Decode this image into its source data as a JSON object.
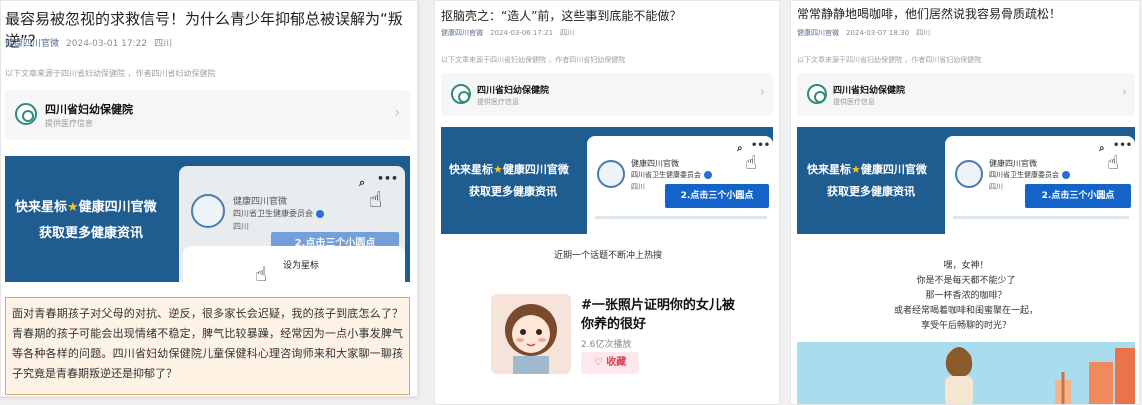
{
  "panels": [
    {
      "title": "最容易被忽视的求救信号！为什么青少年抑郁总被误解为“叛逆”？",
      "author": "健康四川官微",
      "datetime": "2024-03-01 17:22",
      "location": "四川",
      "source": "以下文章来源于四川省妇幼保健院 ，作者四川省妇幼保健院",
      "card": {
        "name": "四川省妇幼保健院",
        "desc": "提供医疗信息"
      },
      "banner": {
        "line1_a": "快来星标",
        "line1_b": "健康四川官微",
        "line2": "获取更多健康资讯",
        "account_name": "健康四川官微",
        "account_dept": "四川省卫生健康委员会",
        "account_loc": "四川",
        "button": "2.点击三个小圆点",
        "popup": "设为星标"
      },
      "intro": "面对青春期孩子对父母的对抗、逆反，很多家长会迟疑，我的孩子到底怎么了？青春期的孩子可能会出现情绪不稳定，脾气比较暴躁，经常因为一点小事发脾气等各种各样的问题。四川省妇幼保健院儿童保健科心理咨询师来和大家聊一聊孩子究竟是青春期叛逆还是抑郁了？"
    },
    {
      "title": "抠脑壳之：“造人”前，这些事到底能不能做？",
      "author": "健康四川官微",
      "datetime": "2024-03-06 17:21",
      "location": "四川",
      "source": "以下文章来源于四川省妇幼保健院 ，作者四川省妇幼保健院",
      "card": {
        "name": "四川省妇幼保健院",
        "desc": "提供医疗信息"
      },
      "banner": {
        "line1_a": "快来星标",
        "line1_b": "健康四川官微",
        "line2": "获取更多健康资讯",
        "account_name": "健康四川官微",
        "account_dept": "四川省卫生健康委员会",
        "account_loc": "四川",
        "button": "2.点击三个小圆点"
      },
      "hot_caption": "近期一个话题不断冲上热搜",
      "topic": {
        "title": "#一张照片证明你的女儿被你养的很好",
        "plays": "2.6亿次播放",
        "collect": "收藏"
      }
    },
    {
      "title": "常常静静地喝咖啡，他们居然说我容易骨质疏松！",
      "author": "健康四川官微",
      "datetime": "2024-03-07 18:30",
      "location": "四川",
      "source": "以下文章来源于四川省妇幼保健院 ，作者四川省妇幼保健院",
      "card": {
        "name": "四川省妇幼保健院",
        "desc": "提供医疗信息"
      },
      "banner": {
        "line1_a": "快来星标",
        "line1_b": "健康四川官微",
        "line2": "获取更多健康资讯",
        "account_name": "健康四川官微",
        "account_dept": "四川省卫生健康委员会",
        "account_loc": "四川",
        "button": "2.点击三个小圆点"
      },
      "poem": [
        "嘿，女神！",
        "你是不是每天都不能少了",
        "那一杯香浓的咖啡？",
        "或者经常喝着咖啡和闺蜜聚在一起，",
        "享受午后畅聊的时光？"
      ]
    }
  ],
  "colors": {
    "banner_blue": "#1f5c8f",
    "button_blue": "#1463c9",
    "author_link": "#576b95",
    "star": "#f7c21b",
    "collect_red": "#e0425b"
  },
  "icons": [
    "search-icon",
    "more-dots-icon",
    "pointing-hand-icon",
    "star-icon",
    "chevron-right-icon",
    "verified-icon",
    "heart-icon"
  ]
}
